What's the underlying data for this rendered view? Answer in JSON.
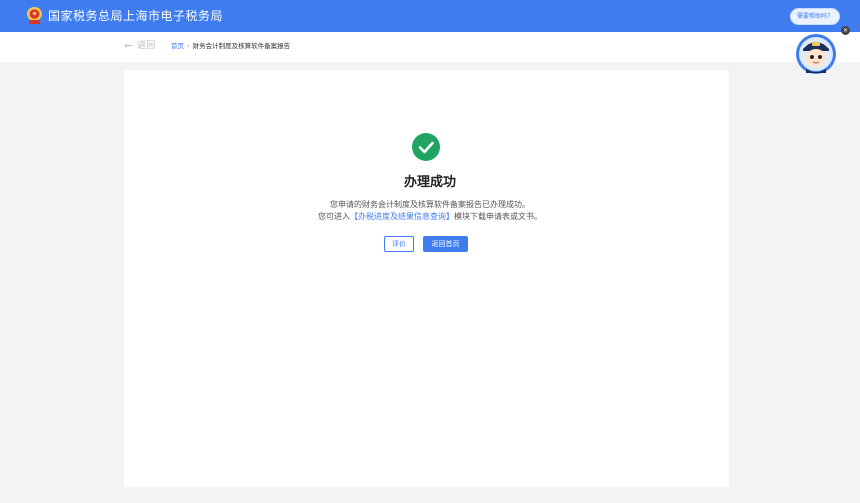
{
  "header": {
    "title": "国家税务总局上海市电子税务局",
    "help_label": "需要帮助吗？"
  },
  "breadcrumb": {
    "back_label": "返回",
    "home_label": "首页",
    "separator": "›",
    "current_label": "财务会计制度及核算软件备案报告"
  },
  "assistant": {
    "badge": "✕"
  },
  "result": {
    "title": "办理成功",
    "line1": "您申请的财务会计制度及核算软件备案报告已办理成功。",
    "line2_prefix": "您可进入",
    "line2_link": "【办税进度及结果信息查询】",
    "line2_suffix": "模块下载申请表或文书。"
  },
  "buttons": {
    "rate_label": "评价",
    "home_label": "返回首页"
  },
  "colors": {
    "primary": "#3e7cf0",
    "success": "#1fa463",
    "background": "#f2f3f5"
  }
}
